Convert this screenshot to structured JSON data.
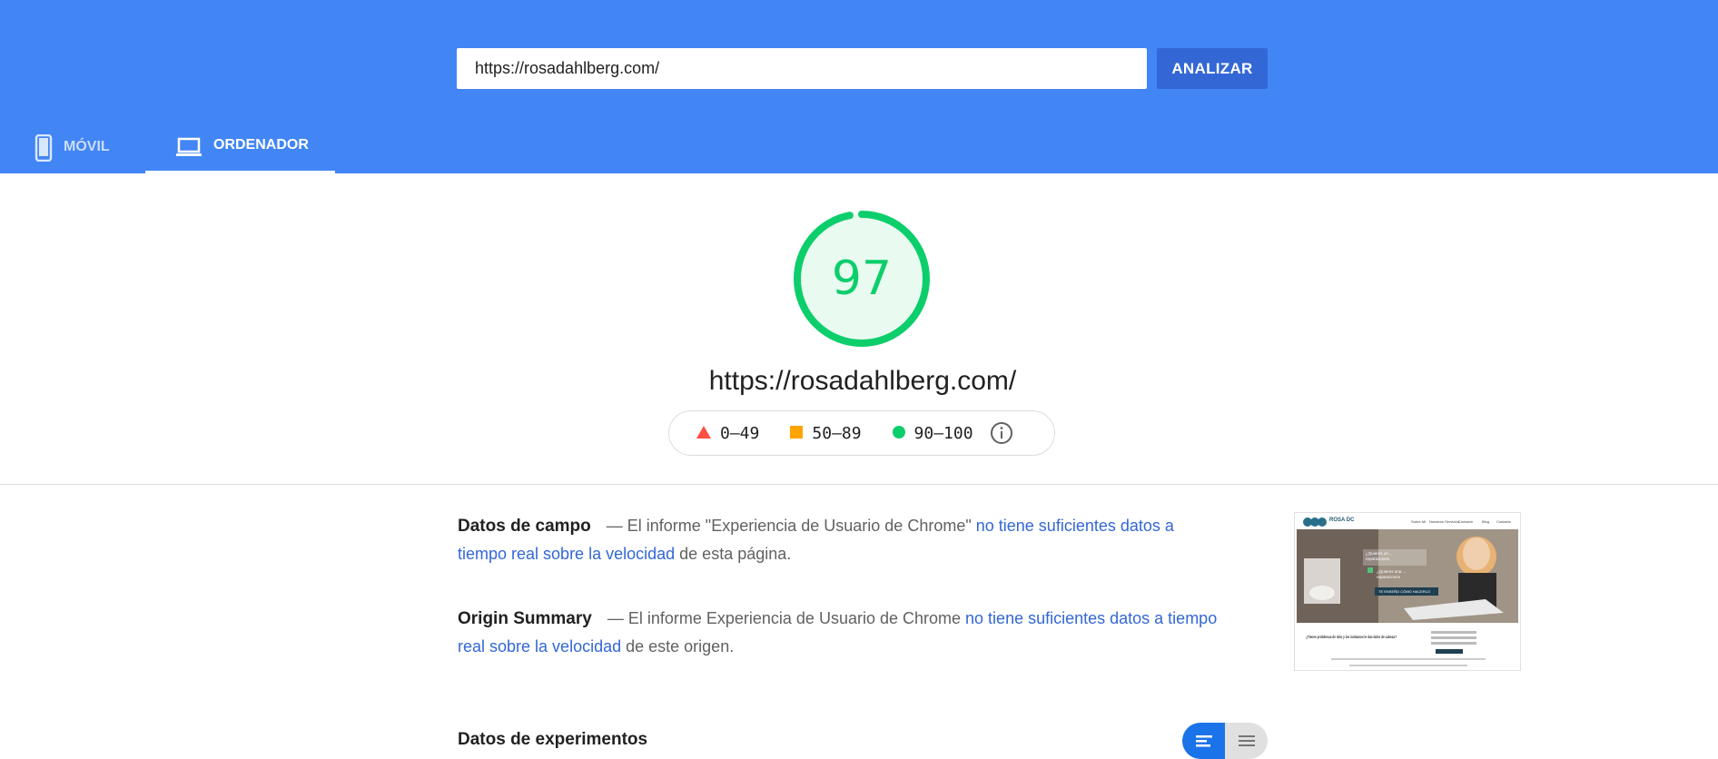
{
  "search": {
    "url_value": "https://rosadahlberg.com/",
    "analyze_label": "ANALIZAR"
  },
  "tabs": [
    {
      "label": "MÓVIL",
      "icon": "smartphone-icon",
      "active": false
    },
    {
      "label": "ORDENADOR",
      "icon": "laptop-icon",
      "active": true
    }
  ],
  "score": {
    "value": "97",
    "fraction": 0.97,
    "color": "#0cce6b",
    "url": "https://rosadahlberg.com/"
  },
  "legend": {
    "fail": {
      "range": "0–49",
      "color": "#ff4e42",
      "icon": "triangle-icon"
    },
    "average": {
      "range": "50–89",
      "color": "#ffa400",
      "icon": "square-icon"
    },
    "pass": {
      "range": "90–100",
      "color": "#0cce6b",
      "icon": "circle-icon"
    },
    "info_icon": "info-icon"
  },
  "field_data": {
    "title": "Datos de campo",
    "prefix": "— El informe \"Experiencia de Usuario de Chrome\"",
    "link": "no tiene suficientes datos a tiempo real sobre la velocidad",
    "suffix": "de esta página."
  },
  "origin_summary": {
    "title": "Origin Summary",
    "prefix": "— El informe Experiencia de Usuario de Chrome",
    "link": "no tiene suficientes datos a tiempo real sobre la velocidad",
    "suffix": "de este origen."
  },
  "thumbnail": {
    "logo_text": "ROSA DC",
    "nav_items": [
      "Sobre Mí",
      "Nuestros Servicios",
      "Contacto",
      "Blog",
      "Contacto"
    ],
    "hero_lines": [
      "¿Quieres un ...",
      "reparaciones",
      "¿Quieres una ...",
      "reparaciones"
    ],
    "hero_button": "TE ENSEÑO CÓMO HACERLO",
    "body_heading": "¿Tienes problemas de sitio y los invitamos le dan dolor de cabeza?"
  },
  "experiments": {
    "title": "Datos de experimentos"
  },
  "view_toggle": {
    "left_icon": "bars-view-icon",
    "right_icon": "list-view-icon"
  }
}
